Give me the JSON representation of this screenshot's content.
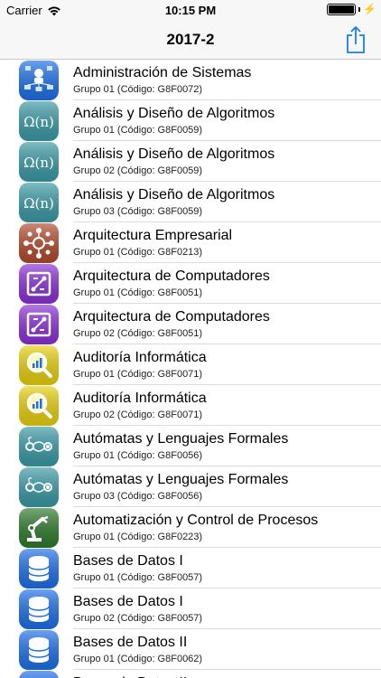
{
  "status_bar": {
    "carrier": "Carrier",
    "time": "10:15 PM",
    "battery_level": 1.0
  },
  "nav": {
    "title": "2017-2",
    "share_icon": "share-icon"
  },
  "courses": [
    {
      "title": "Administración de Sistemas",
      "subtitle": "Grupo 01 (Código: G8F0072)",
      "icon": "network-admin-icon",
      "color": "#1d6fe8"
    },
    {
      "title": "Análisis y Diseño de Algoritmos",
      "subtitle": "Grupo 01 (Código: G8F0059)",
      "icon": "omega-n-icon",
      "color": "#3a9aa6"
    },
    {
      "title": "Análisis y Diseño de Algoritmos",
      "subtitle": "Grupo 02 (Código: G8F0059)",
      "icon": "omega-n-icon",
      "color": "#3a9aa6"
    },
    {
      "title": "Análisis y Diseño de Algoritmos",
      "subtitle": "Grupo 03 (Código: G8F0059)",
      "icon": "omega-n-icon",
      "color": "#3a9aa6"
    },
    {
      "title": "Arquitectura Empresarial",
      "subtitle": "Grupo 01 (Código: G8F0213)",
      "icon": "enterprise-network-icon",
      "color": "#b24a2c"
    },
    {
      "title": "Arquitectura de Computadores",
      "subtitle": "Grupo 01 (Código: G8F0051)",
      "icon": "chip-icon",
      "color": "#8a2fd6"
    },
    {
      "title": "Arquitectura de Computadores",
      "subtitle": "Grupo 02 (Código: G8F0051)",
      "icon": "chip-icon",
      "color": "#8a2fd6"
    },
    {
      "title": "Auditoría Informática",
      "subtitle": "Grupo 01 (Código: G8F0071)",
      "icon": "magnifier-chart-icon",
      "color": "#e8d00e"
    },
    {
      "title": "Auditoría Informática",
      "subtitle": "Grupo 02 (Código: G8F0071)",
      "icon": "magnifier-chart-icon",
      "color": "#e8d00e"
    },
    {
      "title": "Autómatas y Lenguajes Formales",
      "subtitle": "Grupo 01 (Código: G8F0056)",
      "icon": "automaton-icon",
      "color": "#3a9aa6"
    },
    {
      "title": "Autómatas y Lenguajes Formales",
      "subtitle": "Grupo 03 (Código: G8F0056)",
      "icon": "automaton-icon",
      "color": "#3a9aa6"
    },
    {
      "title": "Automatización y Control de Procesos",
      "subtitle": "Grupo 01 (Código: G8F0223)",
      "icon": "robot-arm-icon",
      "color": "#2e7a2c"
    },
    {
      "title": "Bases de Datos I",
      "subtitle": "Grupo 01 (Código: G8F0057)",
      "icon": "database-icon",
      "color": "#1d6fe8"
    },
    {
      "title": "Bases de Datos I",
      "subtitle": "Grupo 02 (Código: G8F0057)",
      "icon": "database-icon",
      "color": "#1d6fe8"
    },
    {
      "title": "Bases de Datos II",
      "subtitle": "Grupo 01 (Código: G8F0062)",
      "icon": "database-icon",
      "color": "#1d6fe8"
    },
    {
      "title": "Bases de Datos II",
      "subtitle": "",
      "icon": "database-icon",
      "color": "#1d6fe8"
    }
  ]
}
